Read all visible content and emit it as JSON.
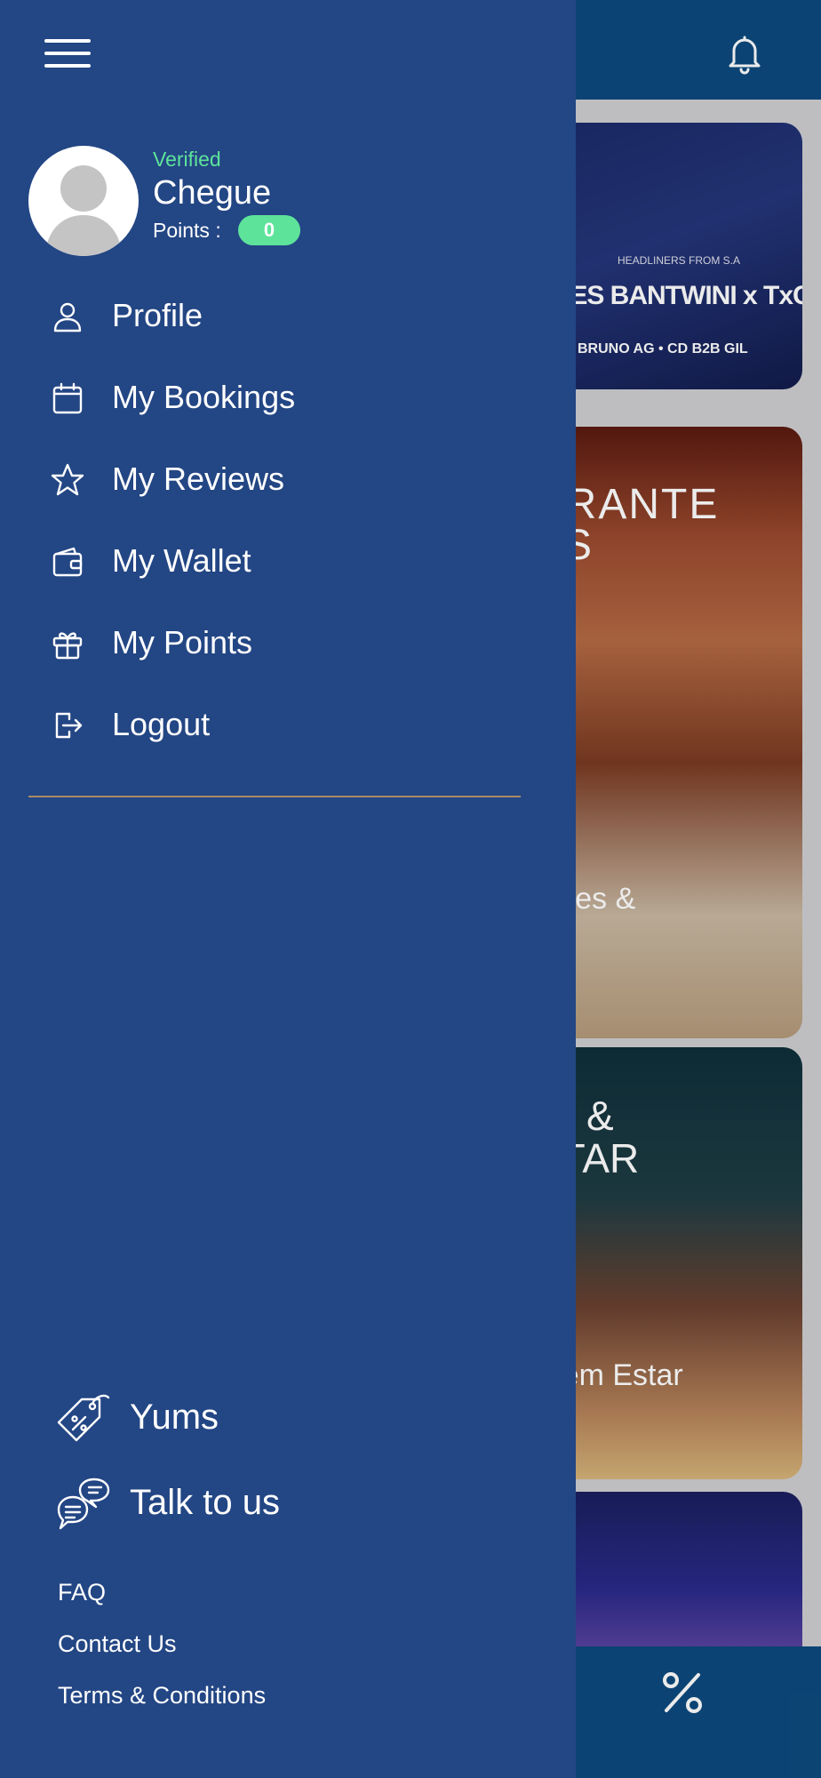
{
  "background": {
    "cards": [
      {
        "lines": [
          "HEADLINERS FROM S.A",
          "AKES BANTWINI  x  TxC  x",
          "BRUNO AG • CD  B2B  GIL"
        ]
      },
      {
        "lines": [
          "URANTE",
          "ES",
          "ántes &"
        ]
      },
      {
        "lines": [
          "&",
          "STAR",
          "Bem Estar"
        ]
      },
      {
        "lines": []
      }
    ]
  },
  "drawer": {
    "profile": {
      "status": "Verified",
      "name": "Chegue",
      "points_label": "Points :",
      "points_value": "0"
    },
    "menu": [
      {
        "label": "Profile",
        "icon": "user-icon"
      },
      {
        "label": "My Bookings",
        "icon": "calendar-icon"
      },
      {
        "label": "My Reviews",
        "icon": "star-icon"
      },
      {
        "label": "My Wallet",
        "icon": "wallet-icon"
      },
      {
        "label": "My Points",
        "icon": "gift-icon"
      },
      {
        "label": "Logout",
        "icon": "logout-icon"
      }
    ],
    "extras": [
      {
        "label": "Yums",
        "icon": "price-tag-icon"
      },
      {
        "label": "Talk to us",
        "icon": "chat-bubbles-icon"
      }
    ],
    "links": [
      "FAQ",
      "Contact Us",
      "Terms & Conditions"
    ]
  },
  "colors": {
    "drawer_bg": "#234684",
    "header_bg": "#0d4a7e",
    "accent_green": "#5ee39b",
    "divider": "#a98a6a"
  }
}
